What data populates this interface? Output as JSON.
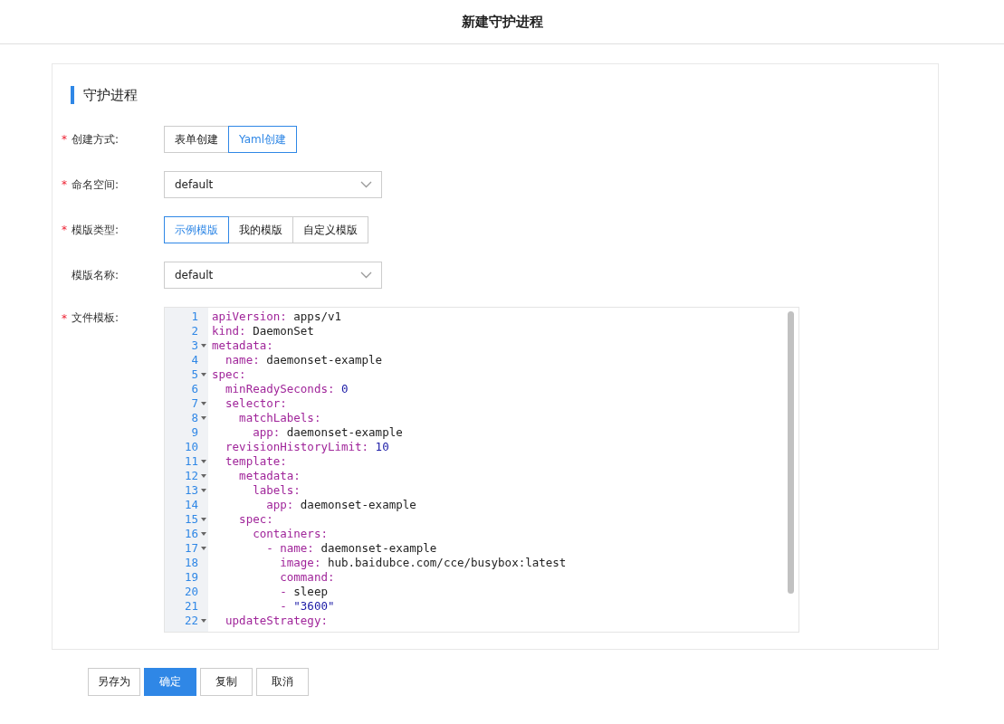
{
  "page_title": "新建守护进程",
  "section_title": "守护进程",
  "fields": [
    {
      "kind": "segmented",
      "label": "创建方式:",
      "required_mark": "*",
      "options": [
        {
          "label": "表单创建",
          "selected": false
        },
        {
          "label": "Yaml创建",
          "selected": true
        }
      ]
    },
    {
      "kind": "select",
      "label": "命名空间:",
      "required_mark": "*",
      "value": "default"
    },
    {
      "kind": "segmented",
      "label": "模版类型:",
      "required_mark": "*",
      "options": [
        {
          "label": "示例模版",
          "selected": true
        },
        {
          "label": "我的模版",
          "selected": false
        },
        {
          "label": "自定义模版",
          "selected": false
        }
      ]
    },
    {
      "kind": "select",
      "label": "模版名称:",
      "value": "default"
    },
    {
      "kind": "editor",
      "label": "文件模板:",
      "required_mark": "*",
      "lines": [
        {
          "number": "1",
          "foldable": false,
          "tokens": [
            {
              "kind": "key",
              "text": "apiVersion:"
            },
            {
              "kind": "plain",
              "text": " apps/v1"
            }
          ]
        },
        {
          "number": "2",
          "foldable": false,
          "tokens": [
            {
              "kind": "key",
              "text": "kind:"
            },
            {
              "kind": "plain",
              "text": " DaemonSet"
            }
          ]
        },
        {
          "number": "3",
          "foldable": true,
          "tokens": [
            {
              "kind": "key",
              "text": "metadata:"
            }
          ]
        },
        {
          "number": "4",
          "foldable": false,
          "tokens": [
            {
              "kind": "key",
              "text": "  name:"
            },
            {
              "kind": "plain",
              "text": " daemonset-example"
            }
          ]
        },
        {
          "number": "5",
          "foldable": true,
          "tokens": [
            {
              "kind": "key",
              "text": "spec:"
            }
          ]
        },
        {
          "number": "6",
          "foldable": false,
          "tokens": [
            {
              "kind": "key",
              "text": "  minReadySeconds:"
            },
            {
              "kind": "number",
              "text": " 0"
            }
          ]
        },
        {
          "number": "7",
          "foldable": true,
          "tokens": [
            {
              "kind": "key",
              "text": "  selector:"
            }
          ]
        },
        {
          "number": "8",
          "foldable": true,
          "tokens": [
            {
              "kind": "key",
              "text": "    matchLabels:"
            }
          ]
        },
        {
          "number": "9",
          "foldable": false,
          "tokens": [
            {
              "kind": "key",
              "text": "      app:"
            },
            {
              "kind": "plain",
              "text": " daemonset-example"
            }
          ]
        },
        {
          "number": "10",
          "foldable": false,
          "tokens": [
            {
              "kind": "key",
              "text": "  revisionHistoryLimit:"
            },
            {
              "kind": "number",
              "text": " 10"
            }
          ]
        },
        {
          "number": "11",
          "foldable": true,
          "tokens": [
            {
              "kind": "key",
              "text": "  template:"
            }
          ]
        },
        {
          "number": "12",
          "foldable": true,
          "tokens": [
            {
              "kind": "key",
              "text": "    metadata:"
            }
          ]
        },
        {
          "number": "13",
          "foldable": true,
          "tokens": [
            {
              "kind": "key",
              "text": "      labels:"
            }
          ]
        },
        {
          "number": "14",
          "foldable": false,
          "tokens": [
            {
              "kind": "key",
              "text": "        app:"
            },
            {
              "kind": "plain",
              "text": " daemonset-example"
            }
          ]
        },
        {
          "number": "15",
          "foldable": true,
          "tokens": [
            {
              "kind": "key",
              "text": "    spec:"
            }
          ]
        },
        {
          "number": "16",
          "foldable": true,
          "tokens": [
            {
              "kind": "key",
              "text": "      containers:"
            }
          ]
        },
        {
          "number": "17",
          "foldable": true,
          "tokens": [
            {
              "kind": "key",
              "text": "        - name:"
            },
            {
              "kind": "plain",
              "text": " daemonset-example"
            }
          ]
        },
        {
          "number": "18",
          "foldable": false,
          "tokens": [
            {
              "kind": "key",
              "text": "          image:"
            },
            {
              "kind": "plain",
              "text": " hub.baidubce.com/cce/busybox:latest"
            }
          ]
        },
        {
          "number": "19",
          "foldable": false,
          "tokens": [
            {
              "kind": "key",
              "text": "          command:"
            }
          ]
        },
        {
          "number": "20",
          "foldable": false,
          "tokens": [
            {
              "kind": "key",
              "text": "          -"
            },
            {
              "kind": "plain",
              "text": " sleep"
            }
          ]
        },
        {
          "number": "21",
          "foldable": false,
          "tokens": [
            {
              "kind": "key",
              "text": "          -"
            },
            {
              "kind": "number",
              "text": " \"3600\""
            }
          ]
        },
        {
          "number": "22",
          "foldable": true,
          "tokens": [
            {
              "kind": "key",
              "text": "  updateStrategy:"
            }
          ]
        }
      ]
    }
  ],
  "buttons": [
    {
      "label": "另存为",
      "primary": false
    },
    {
      "label": "确定",
      "primary": true
    },
    {
      "label": "复制",
      "primary": false
    },
    {
      "label": "取消",
      "primary": false
    }
  ]
}
